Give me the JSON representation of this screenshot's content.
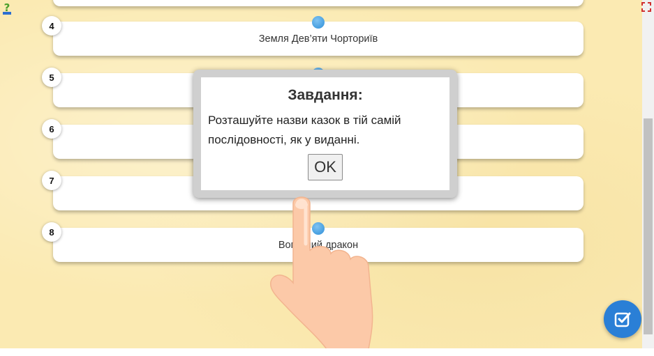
{
  "items": [
    {
      "number": "4",
      "label": "Земля Дев’яти Чорториїв"
    },
    {
      "number": "5",
      "label": ""
    },
    {
      "number": "6",
      "label": ""
    },
    {
      "number": "7",
      "label": ""
    },
    {
      "number": "8",
      "label": "Вогняний дракон"
    }
  ],
  "dialog": {
    "title": "Завдання:",
    "text": "Розташуйте назви казок в тій самій послідовності, як у виданні.",
    "ok_label": "OK"
  },
  "icons": {
    "help": "help-icon",
    "fullscreen": "fullscreen-icon",
    "check": "check-icon",
    "hand": "pointing-hand-icon"
  },
  "colors": {
    "background": "#fbeab2",
    "accent": "#2a7fd6",
    "handle": "#3a9ae0"
  }
}
